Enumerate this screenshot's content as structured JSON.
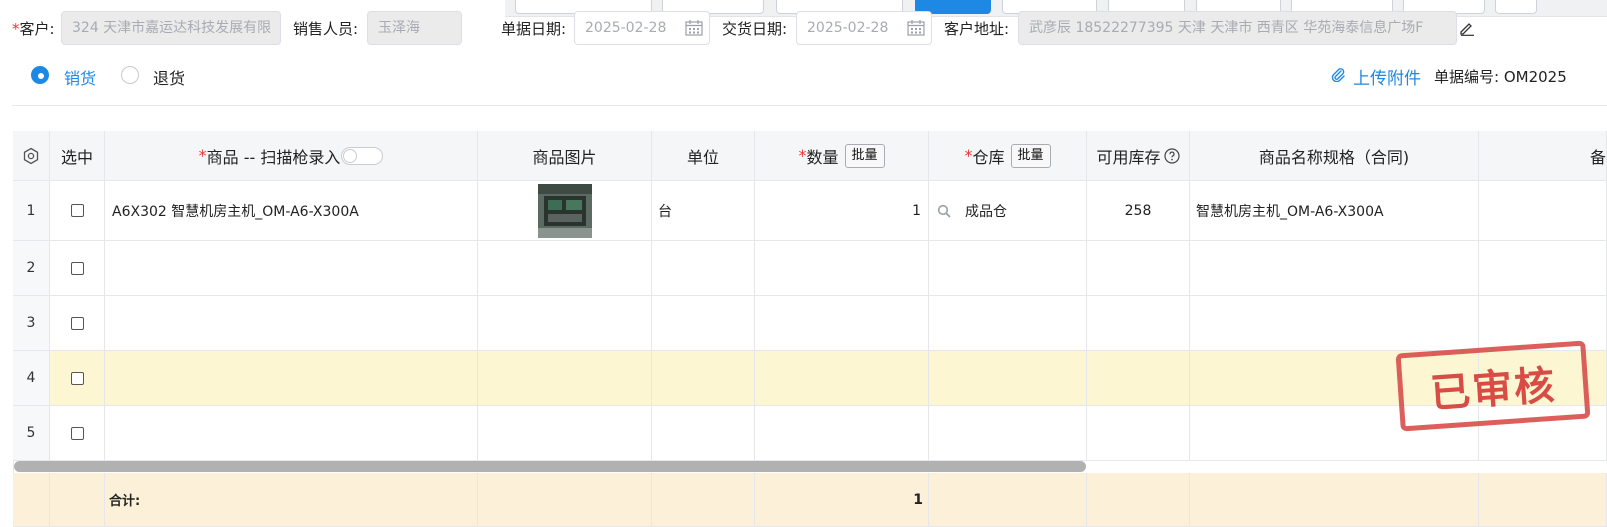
{
  "colors": {
    "accent": "#1e88e5",
    "required": "#e53935",
    "stamp": "#d9534f",
    "highlight_row": "#fdf6d3",
    "total_row": "#fdf0d8"
  },
  "form": {
    "customer_label": "客户:",
    "customer_value": "324 天津市嘉运达科技发展有限",
    "salesperson_label": "销售人员:",
    "salesperson_value": "玉泽海",
    "doc_date_label": "单据日期:",
    "doc_date_value": "2025-02-28",
    "delivery_date_label": "交货日期:",
    "delivery_date_value": "2025-02-28",
    "address_label": "客户地址:",
    "address_value": "武彦辰 18522277395 天津 天津市 西青区 华苑海泰信息广场F"
  },
  "mode": {
    "sale_label": "销货",
    "return_label": "退货",
    "selected": "销货"
  },
  "attach_label": "上传附件",
  "doc_no_label": "单据编号: OM2025",
  "table": {
    "headers": {
      "select": "选中",
      "product": "商品 -- 扫描枪录入",
      "image": "商品图片",
      "unit": "单位",
      "qty": "数量",
      "warehouse": "仓库",
      "stock": "可用库存",
      "name_spec": "商品名称规格（合同)",
      "remark": "备"
    },
    "batch_label": "批量",
    "rows": [
      {
        "num": "1",
        "product": "A6X302 智慧机房主机_OM-A6-X300A",
        "unit": "台",
        "qty": "1",
        "warehouse": "成品仓",
        "stock": "258",
        "name_spec": "智慧机房主机_OM-A6-X300A"
      },
      {
        "num": "2"
      },
      {
        "num": "3"
      },
      {
        "num": "4"
      },
      {
        "num": "5"
      }
    ],
    "total_label": "合计:",
    "total_qty": "1"
  },
  "stamp_text": "已审核"
}
